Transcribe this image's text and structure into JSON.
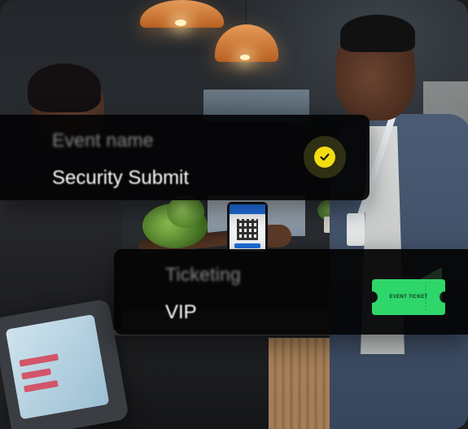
{
  "event_card": {
    "label": "Event name",
    "value": "Security Submit",
    "status_icon": "check-circle-icon",
    "accent": "#F4DC12"
  },
  "ticket_card": {
    "label": "Ticketing",
    "value": "VIP",
    "ticket_icon_text": "EVENT TICKET",
    "accent": "#2FD66A"
  }
}
